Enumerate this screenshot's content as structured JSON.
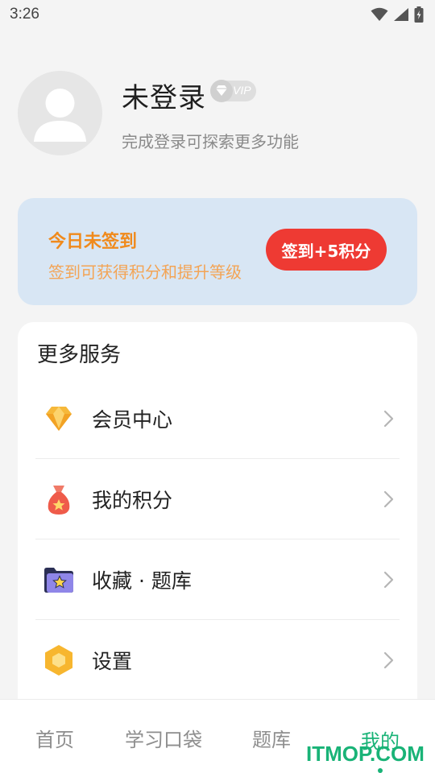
{
  "status_bar": {
    "time": "3:26",
    "icons": [
      "wifi-icon",
      "signal-icon",
      "battery-charging-icon"
    ]
  },
  "profile": {
    "name": "未登录",
    "vip_label": "VIP",
    "subtitle": "完成登录可探索更多功能",
    "avatar_icon": "default-user-icon"
  },
  "checkin": {
    "title": "今日未签到",
    "subtitle": "签到可获得积分和提升等级",
    "button_label": "签到+5积分",
    "colors": {
      "card_bg": "#d8e6f4",
      "title": "#f08a1c",
      "button": "#ee3a33"
    }
  },
  "services": {
    "title": "更多服务",
    "items": [
      {
        "label": "会员中心",
        "icon": "diamond-icon"
      },
      {
        "label": "我的积分",
        "icon": "money-bag-icon"
      },
      {
        "label": "收藏 · 题库",
        "icon": "star-folder-icon"
      },
      {
        "label": "设置",
        "icon": "hexagon-settings-icon"
      }
    ]
  },
  "tabbar": {
    "tabs": [
      {
        "label": "首页",
        "active": false
      },
      {
        "label": "学习口袋",
        "active": false
      },
      {
        "label": "题库",
        "active": false
      },
      {
        "label": "我的",
        "active": true
      }
    ],
    "active_color": "#19b377"
  },
  "watermark": "ITMOP.COM"
}
